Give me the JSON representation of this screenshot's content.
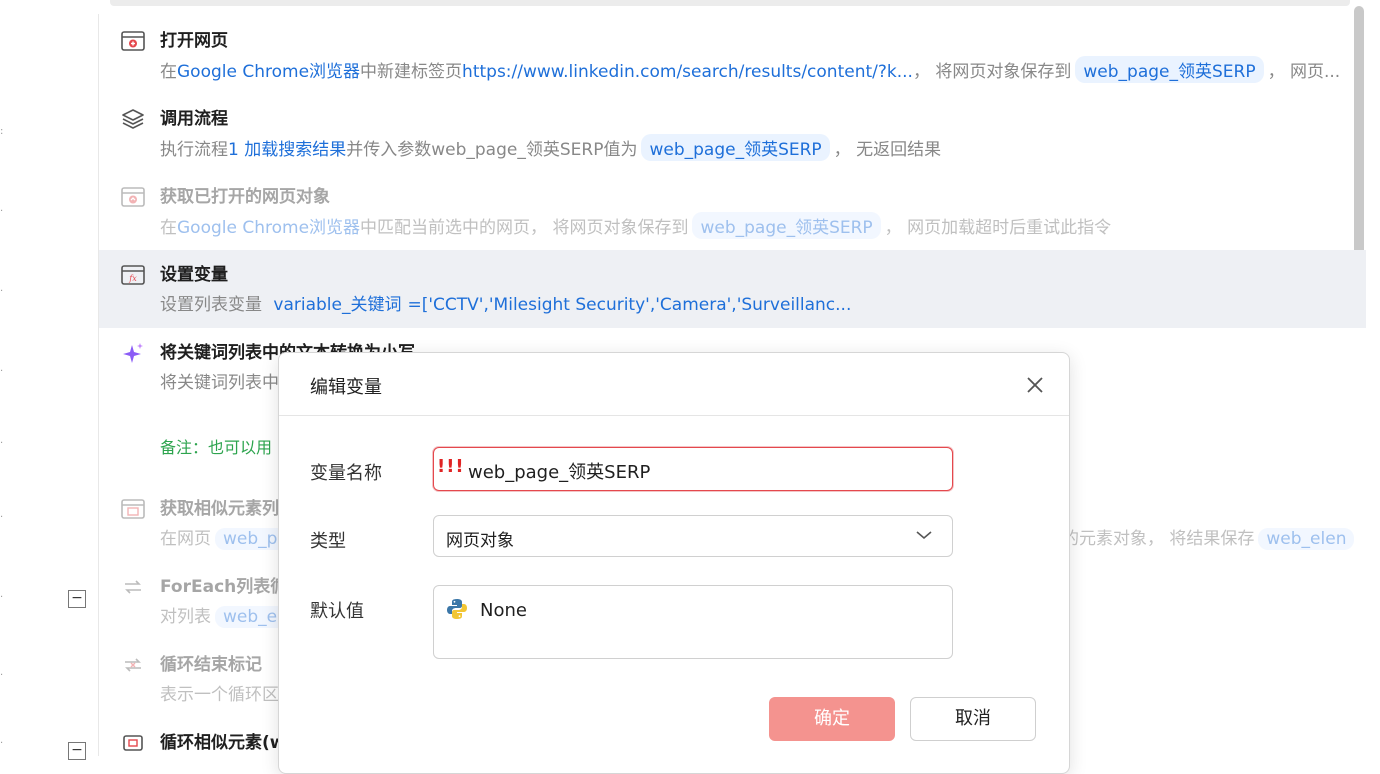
{
  "steps": [
    {
      "title": "打开网页",
      "desc_prefix": "在",
      "desc_link": "Google Chrome浏览器",
      "desc_mid": "中新建标签页",
      "desc_url": "https://www.linkedin.com/search/results/content/?k...",
      "desc_mid2": "， 将网页对象保存到",
      "chip": "web_page_领英SERP",
      "desc_suffix": "， 网页..."
    },
    {
      "title": "调用流程",
      "desc_prefix": "执行流程",
      "desc_link": "1 加载搜索结果",
      "desc_mid": "并传入参数web_page_领英SERP值为",
      "chip": "web_page_领英SERP",
      "desc_suffix": "， 无返回结果"
    },
    {
      "title": "获取已打开的网页对象",
      "desc_prefix": "在",
      "desc_link": "Google Chrome浏览器",
      "desc_mid": "中匹配当前选中的网页， 将网页对象保存到",
      "chip": "web_page_领英SERP",
      "desc_suffix": "， 网页加载超时后重试此指令"
    },
    {
      "title": "设置变量",
      "desc_prefix": "设置列表变量",
      "desc_link": "variable_关键词",
      "desc_value": "=['CCTV','Milesight Security','Camera','Surveillanc..."
    },
    {
      "title": "将关键词列表中的文本转换为小写",
      "desc_prefix": "将关键词列表中"
    },
    {
      "note": "备注：也可以用"
    },
    {
      "title": "获取相似元素列",
      "desc_prefix": "在网页",
      "chip": "web_pa",
      "desc_suffix": "似的元素对象， 将结果保存",
      "chip2": "web_elen"
    },
    {
      "title": "ForEach列表循",
      "desc_prefix": "对列表",
      "chip": "web_ele"
    },
    {
      "title": "循环结束标记",
      "desc_prefix": "表示一个循环区"
    },
    {
      "title": "循环相似元素(w"
    }
  ],
  "dialog": {
    "title": "编辑变量",
    "name_label": "变量名称",
    "name_warning": "!!!",
    "name_value": "web_page_领英SERP",
    "type_label": "类型",
    "type_value": "网页对象",
    "default_label": "默认值",
    "default_value": "None",
    "ok_label": "确定",
    "cancel_label": "取消"
  },
  "colors": {
    "accent_blue": "#1e6fd9",
    "error_red": "#e5484d",
    "ok_button": "#f4938f",
    "note_green": "#2da44e"
  },
  "icons": {
    "open-page": "browser-window-icon",
    "call-flow": "layers-icon",
    "get-page": "browser-upload-icon",
    "set-variable": "fx-window-icon",
    "ai-step": "sparkle-icon",
    "similar-elements": "element-list-icon",
    "foreach": "loop-icon",
    "loop-end": "loop-end-icon",
    "python": "python-icon",
    "close": "close-icon",
    "dropdown": "chevron-down-icon"
  }
}
